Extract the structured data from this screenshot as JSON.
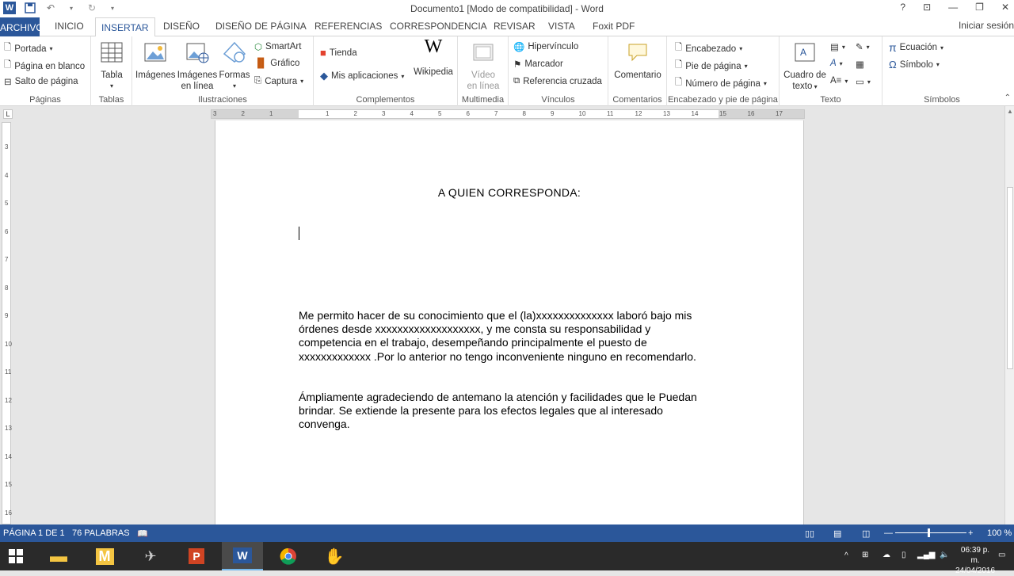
{
  "window": {
    "title": "Documento1 [Modo de compatibilidad] - Word",
    "signin": "Iniciar sesión"
  },
  "tabs": {
    "file": "ARCHIVO",
    "inicio": "INICIO",
    "insertar": "INSERTAR",
    "diseno": "DISEÑO",
    "diseno_pagina": "DISEÑO DE PÁGINA",
    "referencias": "REFERENCIAS",
    "correspondencia": "CORRESPONDENCIA",
    "revisar": "REVISAR",
    "vista": "VISTA",
    "foxit": "Foxit PDF"
  },
  "ribbon": {
    "paginas": {
      "label": "Páginas",
      "portada": "Portada",
      "blanco": "Página en blanco",
      "salto": "Salto de página"
    },
    "tablas": {
      "label": "Tablas",
      "tabla": "Tabla"
    },
    "ilustraciones": {
      "label": "Ilustraciones",
      "imagenes": "Imágenes",
      "imagenes_linea_1": "Imágenes",
      "imagenes_linea_2": "en línea",
      "formas": "Formas",
      "smartart": "SmartArt",
      "grafico": "Gráfico",
      "captura": "Captura"
    },
    "complementos": {
      "label": "Complementos",
      "tienda": "Tienda",
      "mis_apps": "Mis aplicaciones",
      "wikipedia": "Wikipedia"
    },
    "multimedia": {
      "label": "Multimedia",
      "video_1": "Vídeo",
      "video_2": "en línea"
    },
    "vinculos": {
      "label": "Vínculos",
      "hipervinculo": "Hipervínculo",
      "marcador": "Marcador",
      "referencia": "Referencia cruzada"
    },
    "comentarios": {
      "label": "Comentarios",
      "comentario": "Comentario"
    },
    "encabezado": {
      "label": "Encabezado y pie de página",
      "encabezado": "Encabezado",
      "pie": "Pie de página",
      "numero": "Número de página"
    },
    "texto": {
      "label": "Texto",
      "cuadro_1": "Cuadro de",
      "cuadro_2": "texto"
    },
    "simbolos": {
      "label": "Símbolos",
      "ecuacion": "Ecuación",
      "simbolo": "Símbolo"
    }
  },
  "document": {
    "heading": "A QUIEN CORRESPONDA:",
    "para1": "Me permito hacer de su conocimiento que el (la)xxxxxxxxxxxxxx laboró bajo mis órdenes desde xxxxxxxxxxxxxxxxxxx,  y me consta su responsabilidad y competencia en el trabajo, desempeñando principalmente el puesto de xxxxxxxxxxxxx  .Por lo anterior no tengo inconveniente ninguno en recomendarlo.",
    "para2": "Ámpliamente agradeciendo de antemano la atención y facilidades que le Puedan brindar. Se extiende la presente para los efectos legales que al interesado convenga."
  },
  "status": {
    "page": "PÁGINA 1 DE 1",
    "words": "76 PALABRAS",
    "zoom": "100 %"
  },
  "taskbar": {
    "time": "06:39 p. m.",
    "date": "24/04/2016"
  },
  "colors": {
    "accent": "#2b579a",
    "taskbar": "#2a2a2a"
  }
}
